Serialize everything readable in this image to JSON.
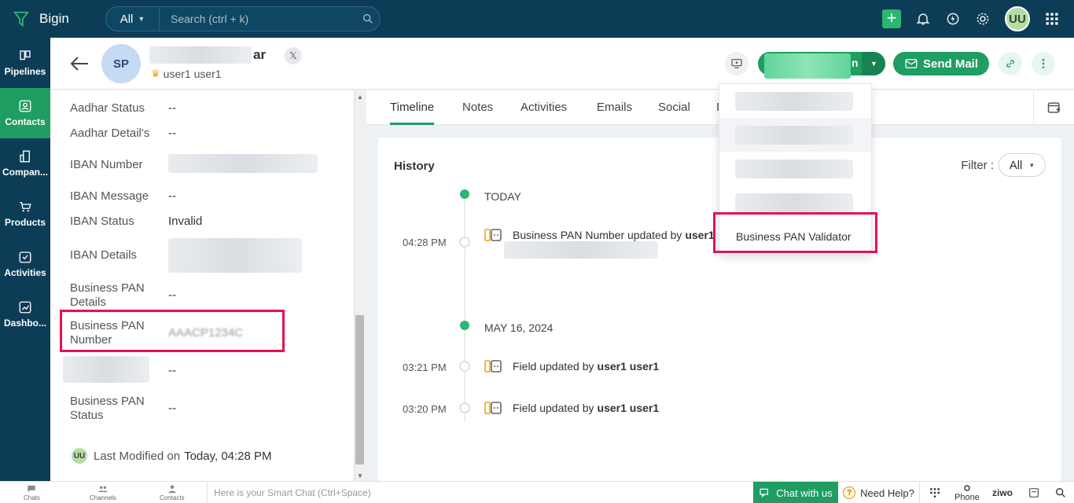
{
  "app": {
    "name": "Bigin"
  },
  "search": {
    "scope": "All",
    "placeholder": "Search (ctrl + k)"
  },
  "user_initials": "UU",
  "nav": [
    {
      "label": "Pipelines",
      "icon": "pipelines-icon"
    },
    {
      "label": "Contacts",
      "icon": "contacts-icon",
      "active": true
    },
    {
      "label": "Compan...",
      "icon": "companies-icon"
    },
    {
      "label": "Products",
      "icon": "products-icon"
    },
    {
      "label": "Activities",
      "icon": "activities-icon"
    },
    {
      "label": "Dashbo...",
      "icon": "dashboards-icon"
    }
  ],
  "contact": {
    "avatar": "SP",
    "name_tail": "ar",
    "x_badge": "𝕏",
    "owner": "user1 user1"
  },
  "header_buttons": {
    "primary_tail": "n",
    "send_mail": "Send Mail"
  },
  "fields": [
    {
      "label": "Aadhar Status",
      "value": "--"
    },
    {
      "label": "Aadhar Detail's",
      "value": "--"
    },
    {
      "label": "IBAN Number",
      "value": ""
    },
    {
      "label": "IBAN Message",
      "value": "--"
    },
    {
      "label": "IBAN Status",
      "value": "Invalid"
    },
    {
      "label": "IBAN Details",
      "value": ""
    },
    {
      "label": "Business PAN Details",
      "value": "--"
    },
    {
      "label": "Business PAN Number",
      "value": "AAACP1234C"
    },
    {
      "label": "",
      "value": "--"
    },
    {
      "label": "Business PAN Status",
      "value": "--"
    }
  ],
  "last_modified": {
    "initials": "UU",
    "label": "Last Modified on",
    "value": "Today, 04:28 PM"
  },
  "tabs": [
    "Timeline",
    "Notes",
    "Activities",
    "Emails",
    "Social",
    "I"
  ],
  "history": {
    "title": "History",
    "filter_label": "Filter :",
    "filter_value": "All",
    "groups": [
      {
        "day": "TODAY",
        "entries": [
          {
            "time": "04:28 PM",
            "text": "Business PAN Number updated by",
            "user": "user1"
          }
        ]
      },
      {
        "day": "MAY 16, 2024",
        "entries": [
          {
            "time": "03:21 PM",
            "text": "Field updated by",
            "user": "user1 user1"
          },
          {
            "time": "03:20 PM",
            "text": "Field updated by",
            "user": "user1 user1"
          }
        ]
      }
    ]
  },
  "dropdown": {
    "last_item": "Business PAN Validator"
  },
  "bottombar": {
    "chats": "Chats",
    "channels": "Channels",
    "contacts": "Contacts",
    "smart_chat_placeholder": "Here is your Smart Chat (Ctrl+Space)",
    "chat_with_us": "Chat with us",
    "need_help": "Need Help?",
    "phone": "Phone",
    "brand": "ziwo"
  },
  "colors": {
    "topbar": "#0d3d56",
    "accent": "#1f9d63",
    "highlight_box": "#e8104f"
  }
}
